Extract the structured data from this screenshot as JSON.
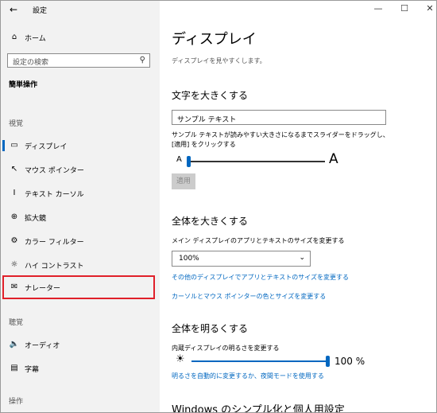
{
  "app": {
    "title": "設定"
  },
  "sidebar": {
    "home_label": "ホーム",
    "search_placeholder": "設定の検索",
    "category_title": "簡単操作",
    "sections": {
      "vision": "視覚",
      "hearing": "聴覚",
      "interaction": "操作"
    },
    "items": [
      {
        "label": "ディスプレイ",
        "icon": "display-icon"
      },
      {
        "label": "マウス ポインター",
        "icon": "mouse-pointer-icon"
      },
      {
        "label": "テキスト カーソル",
        "icon": "text-cursor-icon"
      },
      {
        "label": "拡大鏡",
        "icon": "magnifier-icon"
      },
      {
        "label": "カラー フィルター",
        "icon": "color-filter-icon"
      },
      {
        "label": "ハイ コントラスト",
        "icon": "high-contrast-icon"
      },
      {
        "label": "ナレーター",
        "icon": "narrator-icon"
      },
      {
        "label": "オーディオ",
        "icon": "audio-icon"
      },
      {
        "label": "字幕",
        "icon": "captions-icon"
      }
    ],
    "selected_index": 0,
    "highlight_color": "#e0202a"
  },
  "main": {
    "title": "ディスプレイ",
    "subtitle": "ディスプレイを見やすくします。",
    "text_size": {
      "heading": "文字を大きくする",
      "sample_text": "サンプル テキスト",
      "description": "サンプル テキストが読みやすい大きさになるまでスライダーをドラッグし、[適用] をクリックする",
      "small_a": "A",
      "large_a": "A",
      "slider_value_fraction": 0.0,
      "apply_label": "適用"
    },
    "everything_bigger": {
      "heading": "全体を大きくする",
      "description": "メイン ディスプレイのアプリとテキストのサイズを変更する",
      "dropdown_value": "100%",
      "link_other_displays": "その他のディスプレイでアプリとテキストのサイズを変更する",
      "link_cursor": "カーソルとマウス ポインターの色とサイズを変更する"
    },
    "brightness": {
      "heading": "全体を明るくする",
      "description": "内蔵ディスプレイの明るさを変更する",
      "value_label": "100 %",
      "slider_value_fraction": 1.0,
      "link_night_light": "明るさを自動的に変更するか、夜間モードを使用する"
    },
    "next_heading": "Windows のシンプル化と個人用設定"
  },
  "colors": {
    "accent": "#0067c0"
  }
}
